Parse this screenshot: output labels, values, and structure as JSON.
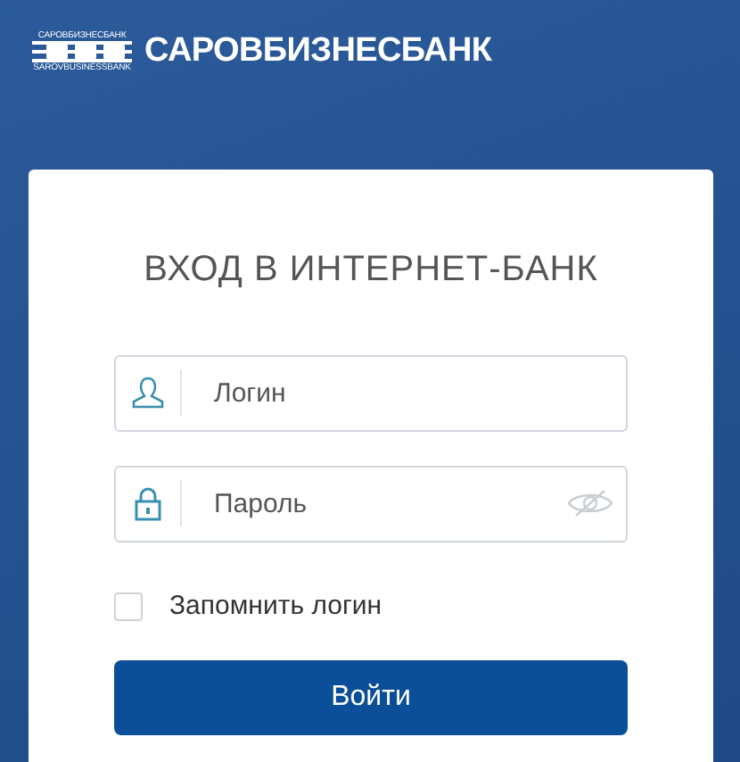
{
  "header": {
    "logo_top": "САРОВБИЗНЕСБАНК",
    "logo_bottom": "SAROVBUSINESSBANK",
    "bank_name": "САРОВБИЗНЕСБАНК"
  },
  "login": {
    "title": "ВХОД В ИНТЕРНЕТ-БАНК",
    "fields": [
      {
        "kind": "login",
        "placeholder": "Логин"
      },
      {
        "kind": "password",
        "placeholder": "Пароль"
      }
    ],
    "remember": {
      "label": "Запомнить логин",
      "checked": false
    },
    "submit": "Войти"
  }
}
